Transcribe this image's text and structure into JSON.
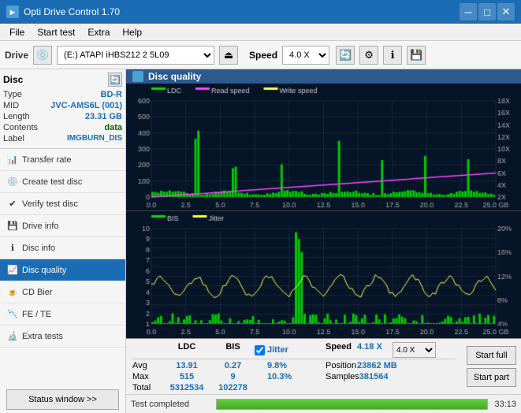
{
  "titlebar": {
    "title": "Opti Drive Control 1.70",
    "icon": "ODC",
    "minimize": "─",
    "maximize": "□",
    "close": "✕"
  },
  "menubar": {
    "items": [
      "File",
      "Start test",
      "Extra",
      "Help"
    ]
  },
  "toolbar": {
    "drive_label": "Drive",
    "drive_value": "(E:) ATAPI iHBS212  2 5L09",
    "speed_label": "Speed",
    "speed_value": "4.0 X"
  },
  "disc": {
    "title": "Disc",
    "type_label": "Type",
    "type_value": "BD-R",
    "mid_label": "MID",
    "mid_value": "JVC-AMS6L (001)",
    "length_label": "Length",
    "length_value": "23.31 GB",
    "contents_label": "Contents",
    "contents_value": "data",
    "label_label": "Label",
    "label_value": "IMGBURN_DIS"
  },
  "nav": {
    "items": [
      {
        "id": "transfer-rate",
        "label": "Transfer rate",
        "active": false
      },
      {
        "id": "create-test-disc",
        "label": "Create test disc",
        "active": false
      },
      {
        "id": "verify-test-disc",
        "label": "Verify test disc",
        "active": false
      },
      {
        "id": "drive-info",
        "label": "Drive info",
        "active": false
      },
      {
        "id": "disc-info",
        "label": "Disc info",
        "active": false
      },
      {
        "id": "disc-quality",
        "label": "Disc quality",
        "active": true
      },
      {
        "id": "cd-bier",
        "label": "CD Bier",
        "active": false
      },
      {
        "id": "fe-te",
        "label": "FE / TE",
        "active": false
      },
      {
        "id": "extra-tests",
        "label": "Extra tests",
        "active": false
      }
    ],
    "status_btn": "Status window >>"
  },
  "chart": {
    "title": "Disc quality",
    "upper": {
      "legend": [
        {
          "label": "LDC",
          "color": "#00cc00"
        },
        {
          "label": "Read speed",
          "color": "#ff00ff"
        },
        {
          "label": "Write speed",
          "color": "#ffff00"
        }
      ],
      "y_left": [
        "0",
        "100",
        "200",
        "300",
        "400",
        "500",
        "600"
      ],
      "y_right": [
        "2X",
        "4X",
        "6X",
        "8X",
        "10X",
        "12X",
        "14X",
        "16X",
        "18X"
      ],
      "x_labels": [
        "0.0",
        "2.5",
        "5.0",
        "7.5",
        "10.0",
        "12.5",
        "15.0",
        "17.5",
        "20.0",
        "22.5",
        "25.0 GB"
      ]
    },
    "lower": {
      "legend": [
        {
          "label": "BIS",
          "color": "#00cc00"
        },
        {
          "label": "Jitter",
          "color": "#ffff00"
        }
      ],
      "y_left": [
        "1",
        "2",
        "3",
        "4",
        "5",
        "6",
        "7",
        "8",
        "9",
        "10"
      ],
      "y_right": [
        "4%",
        "8%",
        "12%",
        "16%",
        "20%"
      ],
      "x_labels": [
        "0.0",
        "2.5",
        "5.0",
        "7.5",
        "10.0",
        "12.5",
        "15.0",
        "17.5",
        "20.0",
        "22.5",
        "25.0 GB"
      ]
    }
  },
  "stats": {
    "headers": [
      "",
      "LDC",
      "BIS",
      "",
      "Jitter",
      "Speed",
      "4.18 X",
      "",
      "4.0 X"
    ],
    "avg_label": "Avg",
    "avg_ldc": "13.91",
    "avg_bis": "0.27",
    "avg_jitter": "9.8%",
    "max_label": "Max",
    "max_ldc": "515",
    "max_bis": "9",
    "max_jitter": "10.3%",
    "total_label": "Total",
    "total_ldc": "5312534",
    "total_bis": "102278",
    "position_label": "Position",
    "position_value": "23862 MB",
    "samples_label": "Samples",
    "samples_value": "381564",
    "jitter_checked": true,
    "speed_label": "Speed",
    "speed_value": "4.18 X",
    "speed_select": "4.0 X"
  },
  "buttons": {
    "start_full": "Start full",
    "start_part": "Start part"
  },
  "statusbar": {
    "text": "Test completed",
    "progress": 100,
    "time": "33:13"
  }
}
